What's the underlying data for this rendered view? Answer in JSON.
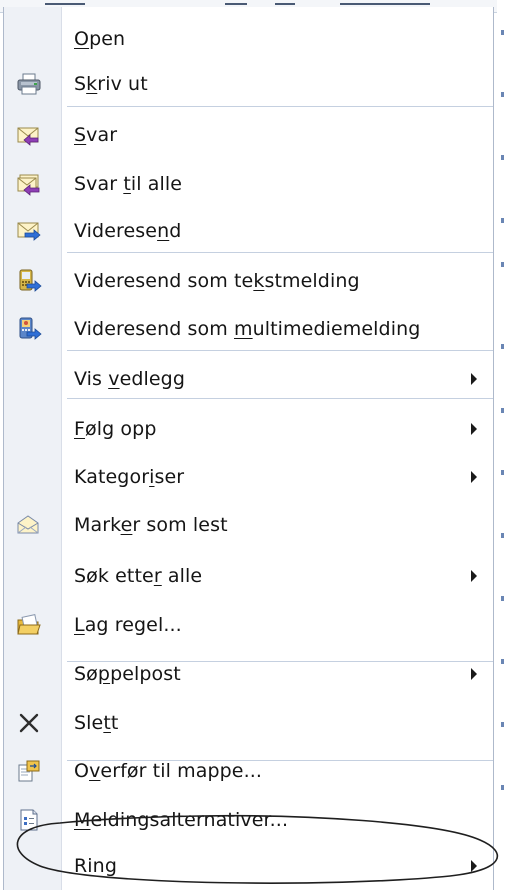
{
  "menu": {
    "items": [
      {
        "pre": "",
        "key": "O",
        "post": "pen",
        "icon": "none-icon",
        "submenu": false
      },
      {
        "pre": "S",
        "key": "k",
        "post": "riv ut",
        "icon": "printer-icon",
        "submenu": false
      },
      {
        "pre": "",
        "key": "S",
        "post": "var",
        "icon": "reply-icon",
        "submenu": false
      },
      {
        "pre": "Svar ",
        "key": "t",
        "post": "il alle",
        "icon": "reply-all-icon",
        "submenu": false
      },
      {
        "pre": "Viderese",
        "key": "n",
        "post": "d",
        "icon": "forward-icon",
        "submenu": false
      },
      {
        "pre": "Videresend som te",
        "key": "k",
        "post": "stmelding",
        "icon": "forward-text-message-icon",
        "submenu": false
      },
      {
        "pre": "Videresend som ",
        "key": "m",
        "post": "ultimediemelding",
        "icon": "forward-multimedia-message-icon",
        "submenu": false
      },
      {
        "pre": "Vis ",
        "key": "v",
        "post": "edlegg",
        "icon": "none-icon",
        "submenu": true
      },
      {
        "pre": "",
        "key": "F",
        "post": "ølg opp",
        "icon": "none-icon",
        "submenu": true
      },
      {
        "pre": "Kategor",
        "key": "i",
        "post": "ser",
        "icon": "none-icon",
        "submenu": true
      },
      {
        "pre": "Mark",
        "key": "e",
        "post": "r som lest",
        "icon": "mark-read-icon",
        "submenu": false
      },
      {
        "pre": "Søk ette",
        "key": "r",
        "post": " alle",
        "icon": "none-icon",
        "submenu": true
      },
      {
        "pre": "",
        "key": "L",
        "post": "ag regel...",
        "icon": "rule-folder-icon",
        "submenu": false
      },
      {
        "pre": "Sø",
        "key": "p",
        "post": "pelpost",
        "icon": "none-icon",
        "submenu": true
      },
      {
        "pre": "Sle",
        "key": "t",
        "post": "t",
        "icon": "delete-icon",
        "submenu": false
      },
      {
        "pre": "O",
        "key": "v",
        "post": "erfør til mappe...",
        "icon": "move-to-folder-icon",
        "submenu": false
      },
      {
        "pre": "",
        "key": "M",
        "post": "eldingsalternativer...",
        "icon": "message-options-icon",
        "submenu": false
      },
      {
        "pre": "Ring",
        "key": "",
        "post": "",
        "icon": "none-icon",
        "submenu": true
      }
    ]
  }
}
